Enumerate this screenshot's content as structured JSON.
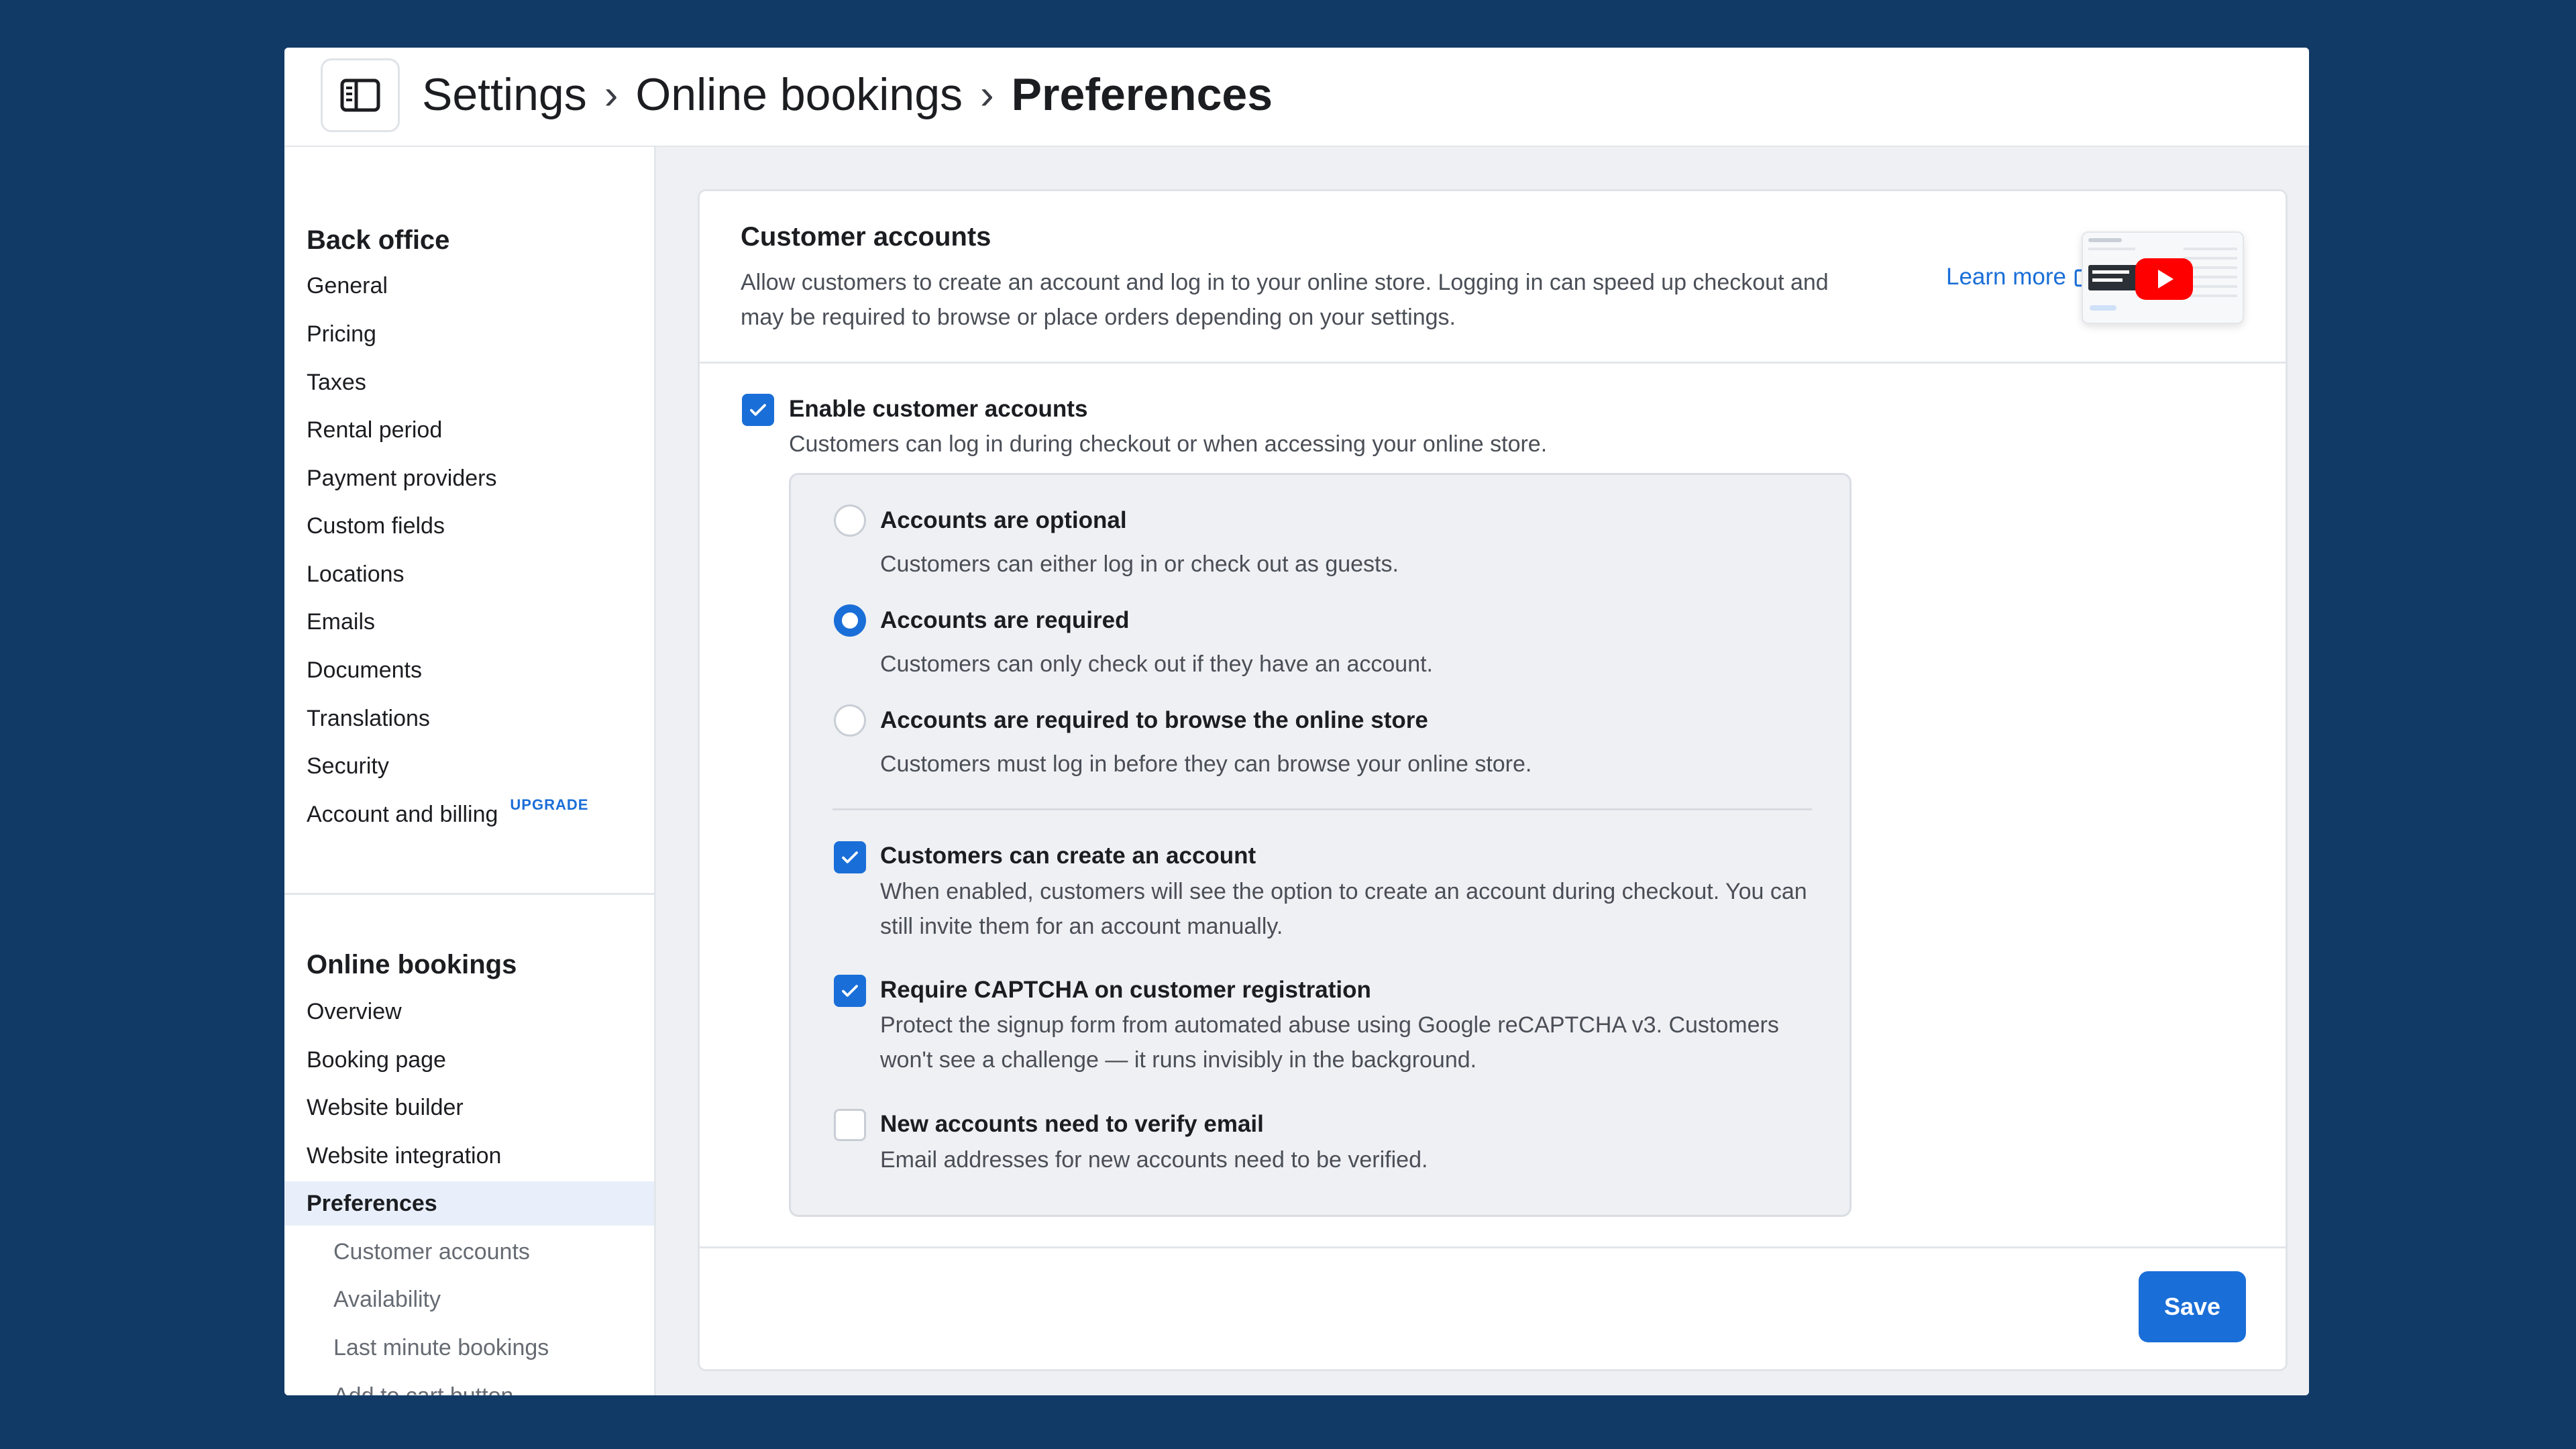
{
  "breadcrumb": {
    "items": [
      "Settings",
      "Online bookings",
      "Preferences"
    ],
    "separator": "›"
  },
  "sidebar": {
    "back_office": {
      "heading": "Back office",
      "items": [
        "General",
        "Pricing",
        "Taxes",
        "Rental period",
        "Payment providers",
        "Custom fields",
        "Locations",
        "Emails",
        "Documents",
        "Translations",
        "Security",
        "Account and billing"
      ],
      "upgrade_badge": "UPGRADE"
    },
    "online_bookings": {
      "heading": "Online bookings",
      "items": [
        "Overview",
        "Booking page",
        "Website builder",
        "Website integration",
        "Preferences"
      ],
      "active": "Preferences",
      "sub_items": [
        "Customer accounts",
        "Availability",
        "Last minute bookings",
        "Add to cart button"
      ]
    }
  },
  "card": {
    "title": "Customer accounts",
    "description": "Allow customers to create an account and log in to your online store. Logging in can speed up checkout and may be required to browse or place orders depending on your settings.",
    "learn_more": "Learn more",
    "video_icon": "play-icon"
  },
  "enable": {
    "label": "Enable customer accounts",
    "description": "Customers can log in during checkout or when accessing your online store.",
    "checked": true
  },
  "account_mode": {
    "selected": "required",
    "options": [
      {
        "key": "optional",
        "label": "Accounts are optional",
        "description": "Customers can either log in or check out as guests."
      },
      {
        "key": "required",
        "label": "Accounts are required",
        "description": "Customers can only check out if they have an account."
      },
      {
        "key": "browse",
        "label": "Accounts are required to browse the online store",
        "description": "Customers must log in before they can browse your online store."
      }
    ]
  },
  "options": [
    {
      "label": "Customers can create an account",
      "description": "When enabled, customers will see the option to create an account during checkout. You can still invite them for an account manually.",
      "checked": true
    },
    {
      "label": "Require CAPTCHA on customer registration",
      "description": "Protect the signup form from automated abuse using Google reCAPTCHA v3. Customers won't see a challenge — it runs invisibly in the background.",
      "checked": true
    },
    {
      "label": "New accounts need to verify email",
      "description": "Email addresses for new accounts need to be verified.",
      "checked": false
    }
  ],
  "footer": {
    "save_label": "Save"
  },
  "colors": {
    "accent": "#1a6ed8",
    "background": "#123a66",
    "youtube_red": "#ff0000"
  }
}
